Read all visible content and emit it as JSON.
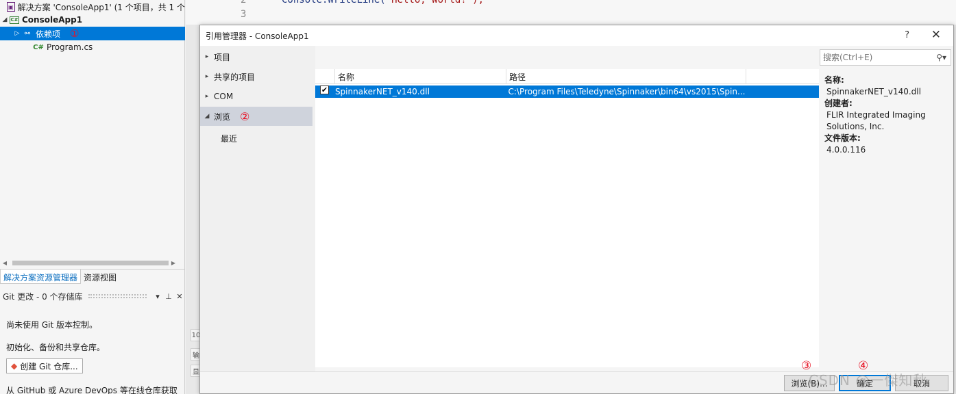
{
  "explorer": {
    "solution_label": "解决方案 'ConsoleApp1' (1 个项目，共 1 个",
    "project_label": "ConsoleApp1",
    "dependencies_label": "依赖项",
    "dependencies_mark": "①",
    "program_label": "Program.cs",
    "tabs": [
      "解决方案资源管理器",
      "资源视图"
    ]
  },
  "git": {
    "header": "Git 更改 - 0 个存储库",
    "line1": "尚未使用 Git 版本控制。",
    "line2": "初始化、备份和共享仓库。",
    "create_button": "创建 Git 仓库...",
    "line3": "从 GitHub 或 Azure DevOps 等在线仓库获取"
  },
  "editor": {
    "line_numbers": [
      "2",
      "3"
    ],
    "code_line": "Console.WriteLine(",
    "code_string": "\"Hello, World!\");",
    "side_labels": [
      "10",
      "输",
      "显"
    ]
  },
  "dialog": {
    "title": "引用管理器 - ConsoleApp1",
    "help": "?",
    "close": "✕",
    "nav": [
      {
        "label": "项目"
      },
      {
        "label": "共享的项目"
      },
      {
        "label": "COM"
      },
      {
        "label": "浏览"
      },
      {
        "label": "最近"
      }
    ],
    "browse_mark": "②",
    "search_placeholder": "搜索(Ctrl+E)",
    "columns": [
      "名称",
      "路径"
    ],
    "rows": [
      {
        "checked": true,
        "name": "SpinnakerNET_v140.dll",
        "path": "C:\\Program Files\\Teledyne\\Spinnaker\\bin64\\vs2015\\Spin..."
      }
    ],
    "details": {
      "name_label": "名称:",
      "name_value": "SpinnakerNET_v140.dll",
      "creator_label": "创建者:",
      "creator_value": "FLIR Integrated Imaging Solutions, Inc.",
      "version_label": "文件版本:",
      "version_value": "4.0.0.116"
    },
    "buttons": {
      "browse": "浏览(B)...",
      "ok": "确定",
      "cancel": "取消"
    },
    "marks": {
      "browse": "③",
      "ok": "④"
    }
  },
  "watermark": "CSDN @一傑知秋",
  "colors": {
    "selection": "#0078d7",
    "annotation": "#e81123"
  }
}
